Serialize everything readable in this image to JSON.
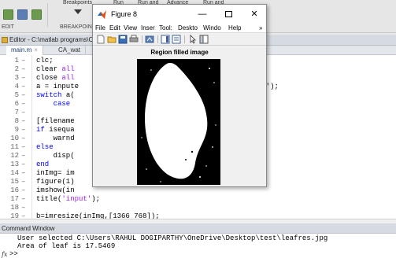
{
  "toolstrip": {
    "links": [
      "Breakpoints",
      "Run",
      "Run and",
      "Advance",
      "Run and"
    ],
    "labels": [
      "EDIT",
      "BREAKPOINTS"
    ]
  },
  "editor": {
    "title": "Editor - C:\\matlab programs\\CA_water.m",
    "tabs": [
      {
        "label": "main.m",
        "close": "×"
      },
      {
        "label": "CA_wat"
      }
    ],
    "lines": [
      {
        "num": "1",
        "segments": [
          {
            "t": "clc;",
            "c": "plain"
          }
        ]
      },
      {
        "num": "2",
        "segments": [
          {
            "t": "clear ",
            "c": "plain"
          },
          {
            "t": "all",
            "c": "str"
          }
        ]
      },
      {
        "num": "3",
        "segments": [
          {
            "t": "close ",
            "c": "plain"
          },
          {
            "t": "all",
            "c": "str"
          }
        ]
      },
      {
        "num": "4",
        "segments": [
          {
            "t": "a = inpute",
            "c": "plain"
          },
          {
            "t": "                            ",
            "c": "plain"
          },
          {
            "t": "r area,canopy:  ",
            "c": "str"
          },
          {
            "t": "');",
            "c": "plain"
          }
        ]
      },
      {
        "num": "5",
        "segments": [
          {
            "t": "switch ",
            "c": "kw"
          },
          {
            "t": "a(",
            "c": "plain"
          }
        ]
      },
      {
        "num": "6",
        "segments": [
          {
            "t": "    ",
            "c": "plain"
          },
          {
            "t": "case",
            "c": "kw"
          }
        ]
      },
      {
        "num": "7",
        "segments": []
      },
      {
        "num": "8",
        "segments": [
          {
            "t": "[filename",
            "c": "plain"
          },
          {
            "t": "                             ",
            "c": "plain"
          },
          {
            "t": "k an mfile'",
            "c": "str"
          },
          {
            "t": ");",
            "c": "plain"
          }
        ]
      },
      {
        "num": "9",
        "segments": [
          {
            "t": "if ",
            "c": "kw"
          },
          {
            "t": "isequa",
            "c": "plain"
          }
        ]
      },
      {
        "num": "10",
        "segments": [
          {
            "t": "    warnd",
            "c": "plain"
          }
        ]
      },
      {
        "num": "11",
        "segments": [
          {
            "t": "else",
            "c": "kw"
          }
        ]
      },
      {
        "num": "12",
        "segments": [
          {
            "t": "    disp(",
            "c": "plain"
          },
          {
            "t": "                             ",
            "c": "plain"
          },
          {
            "t": "e, filename)])",
            "c": "plain"
          }
        ]
      },
      {
        "num": "13",
        "segments": [
          {
            "t": "end",
            "c": "kw"
          }
        ]
      },
      {
        "num": "14",
        "segments": [
          {
            "t": "inImg= im",
            "c": "plain"
          }
        ]
      },
      {
        "num": "15",
        "segments": [
          {
            "t": "figure(1)",
            "c": "plain"
          }
        ]
      },
      {
        "num": "16",
        "segments": [
          {
            "t": "imshow(in",
            "c": "plain"
          }
        ]
      },
      {
        "num": "17",
        "segments": [
          {
            "t": "title(",
            "c": "plain"
          },
          {
            "t": "'input'",
            "c": "str"
          },
          {
            "t": ");",
            "c": "plain"
          }
        ]
      },
      {
        "num": "18",
        "segments": []
      },
      {
        "num": "19",
        "segments": [
          {
            "t": "b=imresize(inImg,[1366 768]);",
            "c": "plain"
          }
        ]
      }
    ]
  },
  "command_window": {
    "title": "Command Window",
    "output": [
      "User selected C:\\Users\\RAHUL DOGIPARTHY\\OneDrive\\Desktop\\test\\leafres.jpg",
      "Area of leaf is 17.5469"
    ],
    "fx": "fx",
    "prompt": ">>"
  },
  "figure_window": {
    "title": "Figure 8",
    "controls": {
      "minimize": "—",
      "maximize": "",
      "close": "✕"
    },
    "menu": [
      "File",
      "Edit",
      "View",
      "Inser",
      "Tool:",
      "Deskto",
      "Windo",
      "Help"
    ],
    "menu_overflow": "»",
    "toolbar_icons": [
      "new-figure-icon",
      "open-icon",
      "save-icon",
      "print-icon",
      "link-plot-icon",
      "insert-colorbar-icon",
      "insert-legend-icon",
      "arrow-pointer-icon",
      "dock-icon"
    ],
    "plot_title": "Region filled image",
    "image": {
      "background": "#000000",
      "foreground": "#ffffff",
      "description_colors": "binary mask"
    }
  }
}
